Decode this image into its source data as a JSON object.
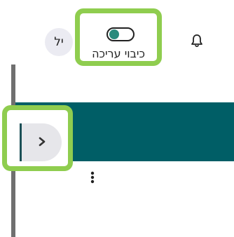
{
  "header": {
    "avatar_initials": "יל",
    "edit_mode": {
      "label": "כיבוי עריכה",
      "enabled": true,
      "accent_color": "#2a8a7c"
    },
    "notifications_icon": "bell-icon"
  },
  "course": {
    "banner_color": "#005e66",
    "sidebar_toggle_icon": "chevron-right-icon",
    "actions_icon": "kebab-menu-icon"
  },
  "highlight_color": "#8fcd4f"
}
